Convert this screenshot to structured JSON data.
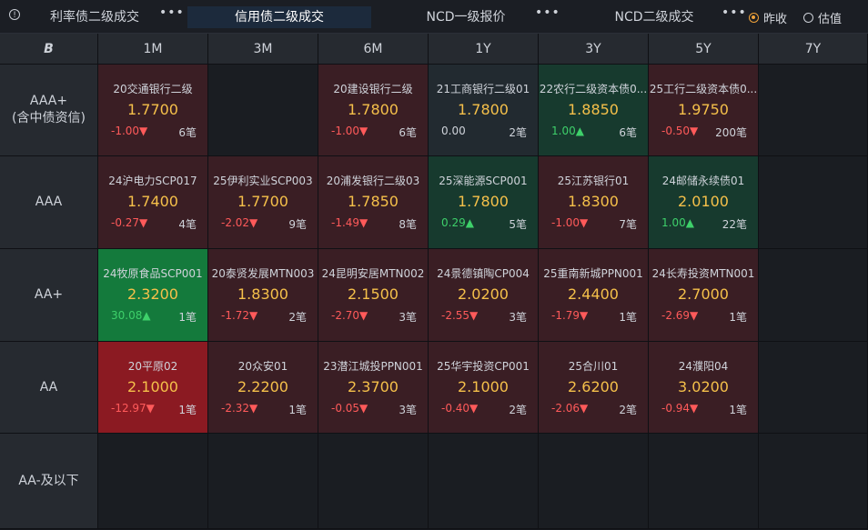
{
  "tabs": [
    {
      "label": "利率债二级成交",
      "active": false
    },
    {
      "label": "信用债二级成交",
      "active": true
    },
    {
      "label": "NCD一级报价",
      "active": false
    },
    {
      "label": "NCD二级成交",
      "active": false
    }
  ],
  "more_label": "•••",
  "radio_options": [
    {
      "label": "昨收",
      "selected": true
    },
    {
      "label": "估值",
      "selected": false
    }
  ],
  "columns": [
    "1M",
    "3M",
    "6M",
    "1Y",
    "3Y",
    "5Y",
    "7Y"
  ],
  "corner_icon": "B",
  "rows": [
    {
      "label_lines": [
        "AAA+",
        "(含中债资信)"
      ],
      "cells": [
        {
          "name": "20交通银行二级",
          "rate": "1.7700",
          "chg": "-1.00▼",
          "dir": "down",
          "count": "6笔",
          "bg": "b-darkred"
        },
        null,
        {
          "name": "20建设银行二级",
          "rate": "1.7800",
          "chg": "-1.00▼",
          "dir": "down",
          "count": "6笔",
          "bg": "b-darkred"
        },
        {
          "name": "21工商银行二级01",
          "rate": "1.7800",
          "chg": "0.00",
          "dir": "flat",
          "count": "2笔",
          "bg": "b-gray"
        },
        {
          "name": "22农行二级资本债0...",
          "rate": "1.8850",
          "chg": "1.00▲",
          "dir": "up",
          "count": "6笔",
          "bg": "b-darkgreen"
        },
        {
          "name": "25工行二级资本债0...",
          "rate": "1.9750",
          "chg": "-0.50▼",
          "dir": "down",
          "count": "200笔",
          "bg": "b-darkred"
        },
        null
      ]
    },
    {
      "label_lines": [
        "AAA"
      ],
      "cells": [
        {
          "name": "24沪电力SCP017",
          "rate": "1.7400",
          "chg": "-0.27▼",
          "dir": "down",
          "count": "4笔",
          "bg": "b-darkred"
        },
        {
          "name": "25伊利实业SCP003",
          "rate": "1.7700",
          "chg": "-2.02▼",
          "dir": "down",
          "count": "9笔",
          "bg": "b-darkred"
        },
        {
          "name": "20浦发银行二级03",
          "rate": "1.7850",
          "chg": "-1.49▼",
          "dir": "down",
          "count": "8笔",
          "bg": "b-darkred"
        },
        {
          "name": "25深能源SCP001",
          "rate": "1.7800",
          "chg": "0.29▲",
          "dir": "up",
          "count": "5笔",
          "bg": "b-darkgreen"
        },
        {
          "name": "25江苏银行01",
          "rate": "1.8300",
          "chg": "-1.00▼",
          "dir": "down",
          "count": "7笔",
          "bg": "b-darkred"
        },
        {
          "name": "24邮储永续债01",
          "rate": "2.0100",
          "chg": "1.00▲",
          "dir": "up",
          "count": "22笔",
          "bg": "b-darkgreen"
        },
        null
      ]
    },
    {
      "label_lines": [
        "AA+"
      ],
      "cells": [
        {
          "name": "24牧原食品SCP001",
          "rate": "2.3200",
          "chg": "30.08▲",
          "dir": "up",
          "count": "1笔",
          "bg": "b-green"
        },
        {
          "name": "20泰贤发展MTN003",
          "rate": "1.8300",
          "chg": "-1.72▼",
          "dir": "down",
          "count": "2笔",
          "bg": "b-darkred"
        },
        {
          "name": "24昆明安居MTN002",
          "rate": "2.1500",
          "chg": "-2.70▼",
          "dir": "down",
          "count": "3笔",
          "bg": "b-darkred"
        },
        {
          "name": "24景德镇陶CP004",
          "rate": "2.0200",
          "chg": "-2.55▼",
          "dir": "down",
          "count": "3笔",
          "bg": "b-darkred"
        },
        {
          "name": "25重南新城PPN001",
          "rate": "2.4400",
          "chg": "-1.79▼",
          "dir": "down",
          "count": "1笔",
          "bg": "b-darkred"
        },
        {
          "name": "24长寿投资MTN001",
          "rate": "2.7000",
          "chg": "-2.69▼",
          "dir": "down",
          "count": "1笔",
          "bg": "b-darkred"
        },
        null
      ]
    },
    {
      "label_lines": [
        "AA"
      ],
      "cells": [
        {
          "name": "20平原02",
          "rate": "2.1000",
          "chg": "-12.97▼",
          "dir": "down",
          "count": "1笔",
          "bg": "b-red"
        },
        {
          "name": "20众安01",
          "rate": "2.2200",
          "chg": "-2.32▼",
          "dir": "down",
          "count": "1笔",
          "bg": "b-darkred"
        },
        {
          "name": "23潜江城投PPN001",
          "rate": "2.3700",
          "chg": "-0.05▼",
          "dir": "down",
          "count": "3笔",
          "bg": "b-darkred"
        },
        {
          "name": "25华宇投资CP001",
          "rate": "2.1000",
          "chg": "-0.40▼",
          "dir": "down",
          "count": "2笔",
          "bg": "b-darkred"
        },
        {
          "name": "25合川01",
          "rate": "2.6200",
          "chg": "-2.06▼",
          "dir": "down",
          "count": "2笔",
          "bg": "b-darkred"
        },
        {
          "name": "24濮阳04",
          "rate": "3.0200",
          "chg": "-0.94▼",
          "dir": "down",
          "count": "1笔",
          "bg": "b-darkred"
        },
        null
      ]
    },
    {
      "label_lines": [
        "AA-及以下"
      ],
      "cells": [
        null,
        null,
        null,
        null,
        null,
        null,
        null
      ]
    }
  ],
  "colors": {
    "rate": "#f5c04a",
    "down": "#ff5a5a",
    "up": "#3ed06a",
    "accent": "#f0a23a"
  }
}
